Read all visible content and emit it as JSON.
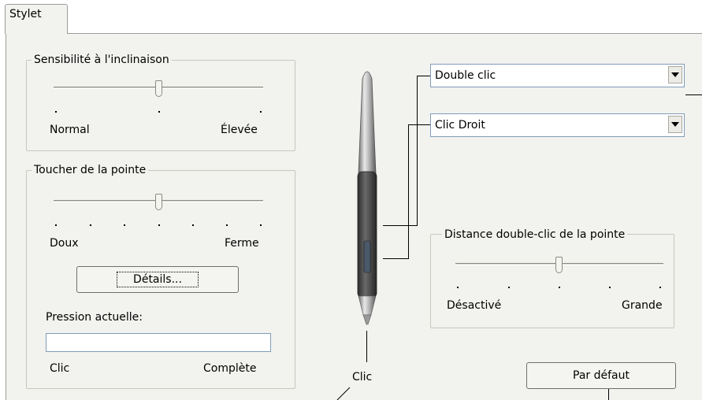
{
  "tab": {
    "label": "Stylet"
  },
  "tilt": {
    "title": "Sensibilité à l'inclinaison",
    "min_label": "Normal",
    "max_label": "Élevée",
    "level": 0.5
  },
  "tip_feel": {
    "title": "Toucher de la pointe",
    "min_label": "Doux",
    "max_label": "Ferme",
    "level": 0.5,
    "details_button": "Détails...",
    "current_pressure_label": "Pression actuelle:",
    "pressure_min_label": "Clic",
    "pressure_max_label": "Complète",
    "current_pressure": 0
  },
  "pen": {
    "upper_button_value": "Double clic",
    "lower_button_value": "Clic Droit",
    "tip_label": "Clic"
  },
  "double_click_distance": {
    "title": "Distance double-clic de la pointe",
    "min_label": "Désactivé",
    "max_label": "Grande",
    "level": 0.5
  },
  "default_button": "Par défaut",
  "icons": [
    "dropdown-arrow-icon",
    "pen-stylus-icon"
  ]
}
